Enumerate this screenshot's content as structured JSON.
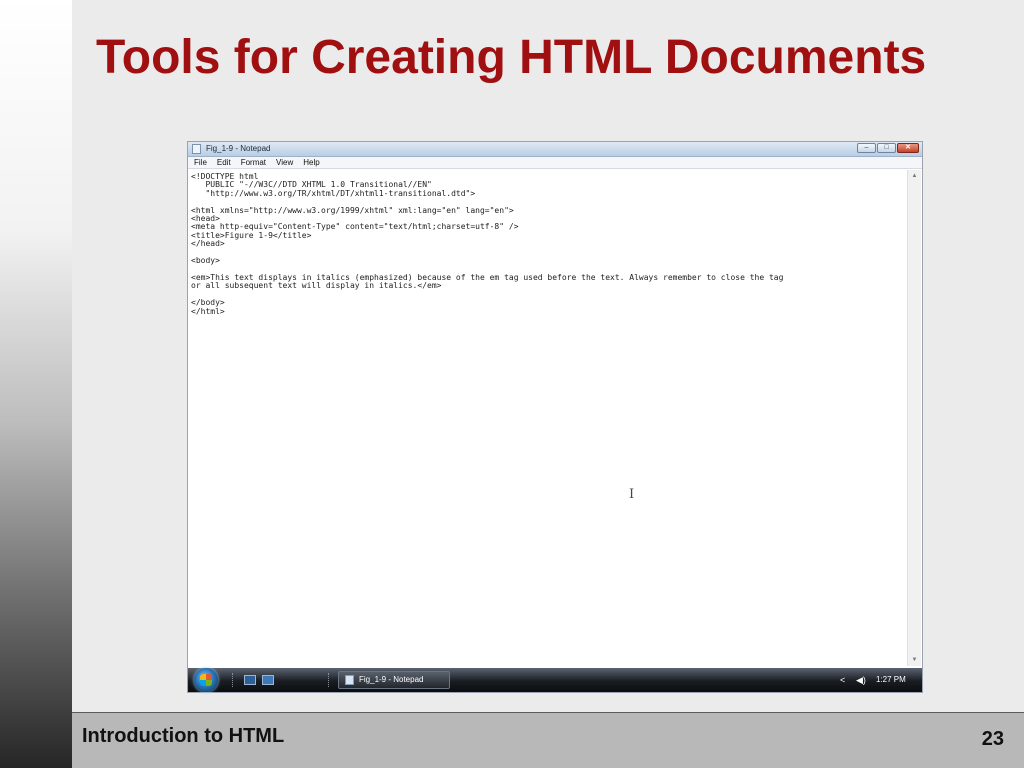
{
  "slide": {
    "title": "Tools for Creating HTML Documents",
    "footer_text": "Introduction to HTML",
    "page_number": "23",
    "title_color": "#a01010"
  },
  "notepad": {
    "window_title": "Fig_1-9 - Notepad",
    "controls": {
      "minimize": "–",
      "maximize": "□",
      "close": "✕"
    },
    "menu": [
      "File",
      "Edit",
      "Format",
      "View",
      "Help"
    ],
    "content": "<!DOCTYPE html\n   PUBLIC \"-//W3C//DTD XHTML 1.0 Transitional//EN\"\n   \"http://www.w3.org/TR/xhtml/DT/xhtml1-transitional.dtd\">\n\n<html xmlns=\"http://www.w3.org/1999/xhtml\" xml:lang=\"en\" lang=\"en\">\n<head>\n<meta http-equiv=\"Content-Type\" content=\"text/html;charset=utf-8\" />\n<title>Figure 1-9</title>\n</head>\n\n<body>\n\n<em>This text displays in italics (emphasized) because of the em tag used before the text. Always remember to close the tag\nor all subsequent text will display in italics.</em>\n\n</body>\n</html>",
    "caret_glyph": "I",
    "scroll_up": "▲",
    "scroll_down": "▼"
  },
  "taskbar": {
    "task_label": "Fig_1-9 - Notepad",
    "clock": "1:27 PM",
    "tray_arrow": "<",
    "volume_glyph": "◀)"
  },
  "icons": {
    "start_orb": "windows-start-icon",
    "quick_launch": [
      "show-desktop-icon",
      "switch-windows-icon"
    ],
    "tray": [
      "tray-arrow-icon",
      "volume-icon"
    ]
  }
}
